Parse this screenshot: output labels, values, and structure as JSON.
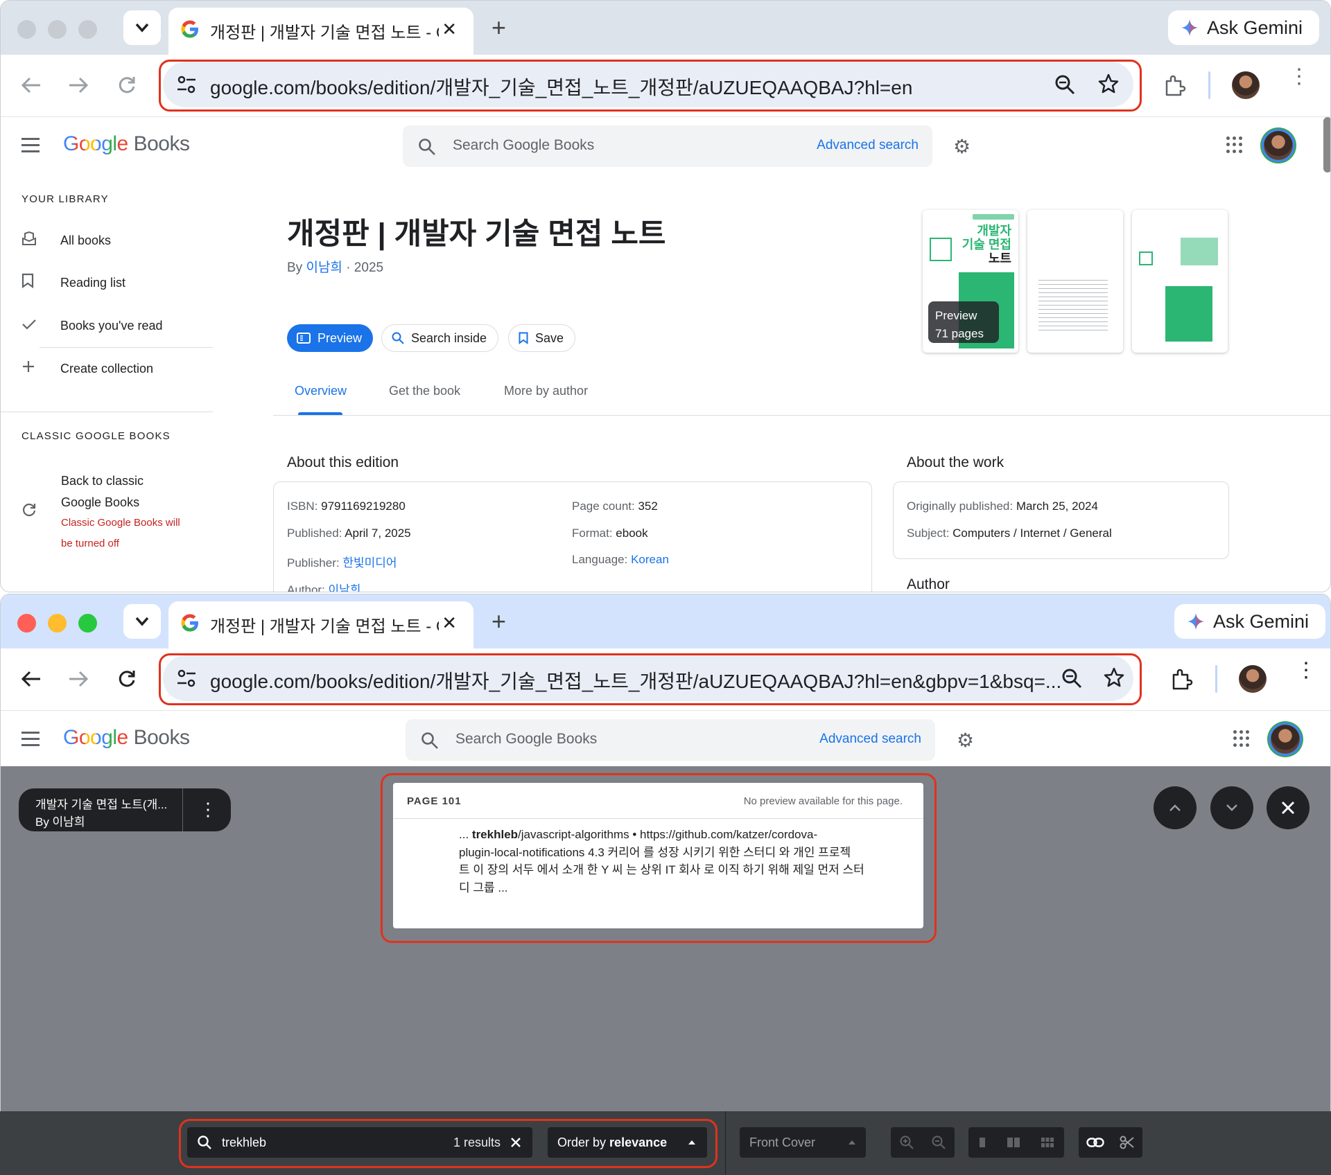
{
  "tab": {
    "title": "개정판 | 개발자 기술 면접 노트 - G",
    "ask_gemini": "Ask Gemini"
  },
  "window1": {
    "url": "google.com/books/edition/개발자_기술_면접_노트_개정판/aUZUEQAAQBAJ?hl=en"
  },
  "window2": {
    "url": "google.com/books/edition/개발자_기술_면접_노트_개정판/aUZUEQAAQBAJ?hl=en&gbpv=1&bsq=..."
  },
  "header": {
    "logo_google": "Google",
    "logo_books": "Books",
    "search_placeholder": "Search Google Books",
    "advanced_search": "Advanced search"
  },
  "sidebar": {
    "library_heading": "YOUR LIBRARY",
    "items": [
      {
        "label": "All books",
        "icon": "books-icon"
      },
      {
        "label": "Reading list",
        "icon": "bookmark-icon"
      },
      {
        "label": "Books you've read",
        "icon": "check-icon"
      },
      {
        "label": "Create collection",
        "icon": "plus-icon"
      }
    ],
    "classic_heading": "CLASSIC GOOGLE BOOKS",
    "classic_line1": "Back to classic",
    "classic_line2": "Google Books",
    "classic_warn1": "Classic Google Books will",
    "classic_warn2": "be turned off"
  },
  "book": {
    "title": "개정판 | 개발자 기술 면접 노트",
    "by": "By",
    "author": "이남희",
    "year": "· 2025",
    "preview": "Preview",
    "search_inside": "Search inside",
    "save": "Save",
    "thumb_preview": "Preview",
    "thumb_pages": "71 pages",
    "cover_title_a": "개발자",
    "cover_title_b": "기술 면접",
    "cover_title_c": "노트"
  },
  "tabs": [
    "Overview",
    "Get the book",
    "More by author"
  ],
  "about_edition": {
    "heading": "About this edition",
    "isbn_k": "ISBN: ",
    "isbn_v": "9791169219280",
    "published_k": "Published: ",
    "published_v": "April 7, 2025",
    "publisher_k": "Publisher: ",
    "publisher_v": "한빛미디어",
    "author_k": "Author: ",
    "author_v": "이남희",
    "pages_k": "Page count: ",
    "pages_v": "352",
    "format_k": "Format: ",
    "format_v": "ebook",
    "language_k": "Language: ",
    "language_v": "Korean"
  },
  "about_work": {
    "heading": "About the work",
    "orig_k": "Originally published: ",
    "orig_v": "March 25, 2024",
    "subject_k": "Subject: ",
    "subject_v": "Computers / Internet / General",
    "author_heading": "Author"
  },
  "viewer": {
    "book_chip_title": "개발자 기술 면접 노트(개...",
    "book_chip_author": "By 이남희",
    "page_label": "PAGE 101",
    "no_preview": "No preview available for this page.",
    "snippet_prefix": "... ",
    "snippet_match": "trekhleb",
    "snippet_rest1": "/javascript-algorithms • https://github.com/katzer/cordova-",
    "snippet_line2": "plugin-local-notifications 4.3 커리어 를 성장 시키기 위한 스터디 와 개인 프로젝",
    "snippet_line3": "트 이 장의 서두 에서 소개 한 Y 씨 는 상위 IT 회사 로 이직 하기 위해 제일 먼저 스터",
    "snippet_line4": "디 그룹 ..."
  },
  "bottom_bar": {
    "query": "trekhleb",
    "results": "1 results",
    "order_prefix": "Order by ",
    "order_value": "relevance",
    "front_cover": "Front Cover"
  },
  "colors": {
    "accent": "#1a73e8",
    "highlight_red": "#e0321e",
    "viewer_bg": "#7d8086",
    "cover_green": "#2bb673"
  }
}
